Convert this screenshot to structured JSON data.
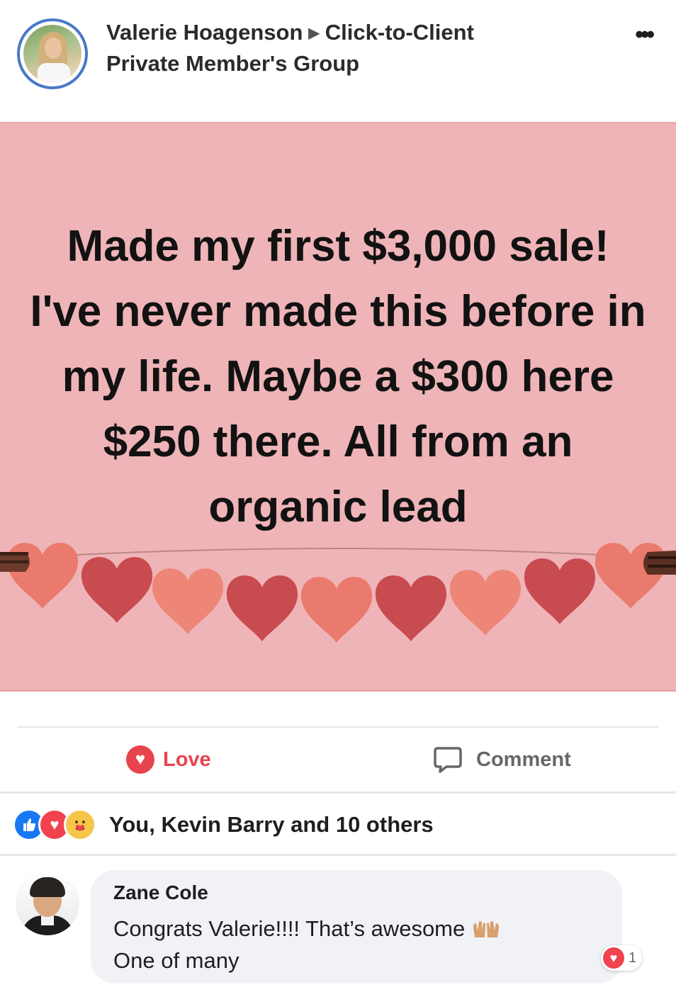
{
  "post": {
    "author_name": "Valerie Hoagenson",
    "group_name": "Click-to-Client",
    "group_type": "Private Member's Group",
    "more_label": "•••",
    "image_text": "Made my first $3,000 sale! I've never made this before in my life. Maybe a $300 here $250 there. All from an organic lead"
  },
  "actions": {
    "love_label": "Love",
    "comment_label": "Comment"
  },
  "reactions": {
    "summary": "You, Kevin Barry and 10 others",
    "types": [
      "like",
      "love",
      "care"
    ]
  },
  "comment": {
    "author": "Zane Cole",
    "text_line1": "Congrats Valerie!!!! That’s awesome",
    "text_line2": "One of many",
    "emoji": "raising-hands",
    "reaction_count": "1"
  },
  "colors": {
    "image_background": "#efb4b7",
    "love_red": "#e8444e",
    "like_blue": "#1877f2",
    "avatar_ring": "#4a78c8",
    "bubble": "#f0f2f5"
  }
}
